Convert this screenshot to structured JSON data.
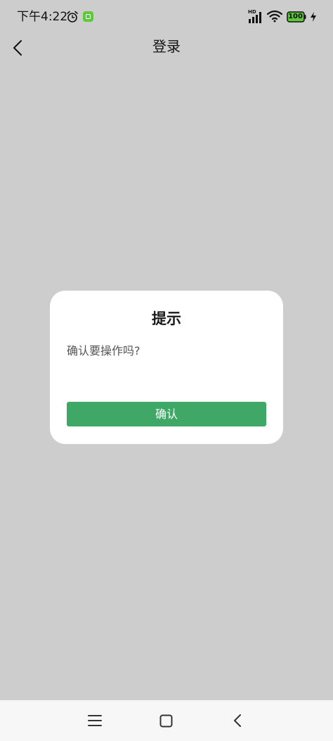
{
  "status_bar": {
    "time": "下午4:22",
    "network_badge": "HD",
    "battery_level": "100",
    "icons": [
      "alarm-icon",
      "app-notify-icon",
      "signal-icon",
      "wifi-icon",
      "battery-icon",
      "charging-icon"
    ]
  },
  "nav_bar": {
    "title": "登录",
    "back_icon": "chevron-left-icon"
  },
  "dialog": {
    "title": "提示",
    "message": "确认要操作吗?",
    "confirm_label": "确认"
  },
  "system_nav": {
    "icons": [
      "menu-icon",
      "home-icon",
      "back-icon"
    ]
  },
  "colors": {
    "overlay_background": "#cdcdcd",
    "dialog_background": "#ffffff",
    "confirm_button": "#3fa866",
    "system_nav_background": "#f7f7f7",
    "app_notify_icon": "#5cc93a"
  }
}
